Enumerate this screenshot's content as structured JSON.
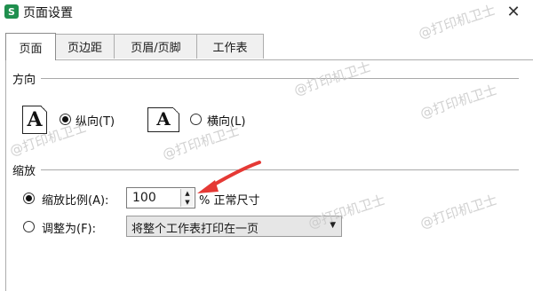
{
  "window": {
    "app_icon_letter": "S",
    "title": "页面设置",
    "close_glyph": "✕"
  },
  "tabs": [
    {
      "label": "页面",
      "active": true
    },
    {
      "label": "页边距",
      "active": false
    },
    {
      "label": "页眉/页脚",
      "active": false
    },
    {
      "label": "工作表",
      "active": false
    }
  ],
  "orientation": {
    "group_label": "方向",
    "portrait_glyph": "A",
    "portrait_label": "纵向(T)",
    "landscape_glyph": "A",
    "landscape_label": "横向(L)",
    "selected": "portrait"
  },
  "scaling": {
    "group_label": "缩放",
    "scale_option_label": "缩放比例(A):",
    "scale_value": "100",
    "scale_suffix": "% 正常尺寸",
    "fit_option_label": "调整为(F):",
    "fit_select_value": "将整个工作表打印在一页",
    "selected": "scale"
  },
  "spinner": {
    "up_glyph": "▲",
    "down_glyph": "▼"
  },
  "select_arrow_glyph": "▼",
  "watermark_text": "@打印机卫士",
  "annotation_arrow_color": "#e53935",
  "accent_app_icon_color": "#1f8f4e"
}
